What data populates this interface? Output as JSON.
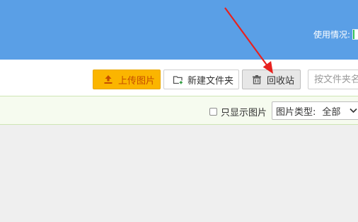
{
  "header": {
    "usage_label": "使用情况:"
  },
  "toolbar": {
    "upload_label": "上传图片",
    "new_folder_label": "新建文件夹",
    "recycle_label": "回收站",
    "search_placeholder": "按文件夹名称"
  },
  "filter": {
    "only_images_label": "只显示图片",
    "only_images_checked": false,
    "type_label": "图片类型:",
    "type_value": "全部"
  },
  "annotation": {
    "arrow_color": "#e8211e"
  },
  "icons": {
    "upload": "upload-icon",
    "new_folder": "folder-add-icon",
    "recycle": "trash-icon",
    "dropdown": "chevron-down-icon"
  },
  "colors": {
    "header_bg": "#5a9fe6",
    "upload_bg": "#fbb500",
    "upload_text": "#c54d00",
    "filter_bg": "#f6fbef"
  }
}
